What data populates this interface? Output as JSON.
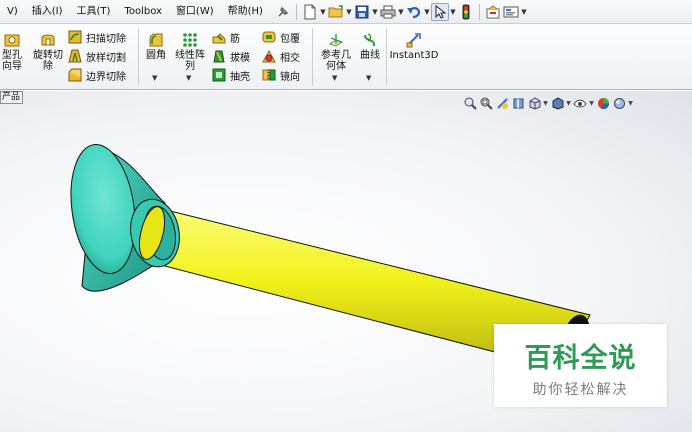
{
  "menubar": {
    "items": [
      "V)",
      "插入(I)",
      "工具(T)",
      "Toolbox",
      "窗口(W)",
      "帮助(H)"
    ]
  },
  "ribbon": {
    "hole_wizard": "型孔\n向导",
    "revolve_cut": "旋转切\n除",
    "sweep_cut": "扫描切除",
    "loft_cut": "放样切割",
    "boundary_cut": "边界切除",
    "fillet": "圆角",
    "linear_pattern": "线性阵\n列",
    "rib": "筋",
    "draft": "拔模",
    "shell": "抽壳",
    "wrap": "包覆",
    "intersect": "相交",
    "mirror": "镜向",
    "ref_geometry": "参考几\n何体",
    "curves": "曲线",
    "instant3d": "Instant3D"
  },
  "tab": {
    "label": "产品"
  },
  "model": {
    "colors": {
      "flange": "#3fd3bd",
      "shaft": "#f2f21b",
      "cap": "#111111"
    },
    "icons": [
      "flange-icon"
    ]
  },
  "watermark": {
    "title": "百科全说",
    "subtitle": "助你轻松解决"
  }
}
